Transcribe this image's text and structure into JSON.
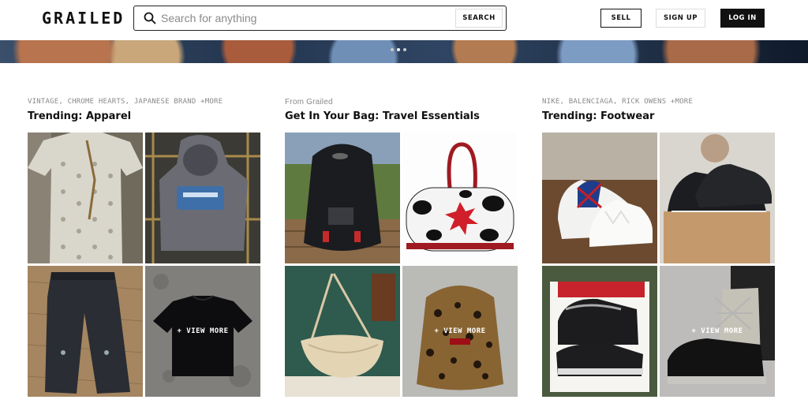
{
  "header": {
    "logo": "GRAILED",
    "search": {
      "placeholder": "Search for anything",
      "value": "",
      "button": "SEARCH"
    },
    "sell": "SELL",
    "signup": "SIGN UP",
    "login": "LOG IN"
  },
  "carousel": {
    "dots": 3,
    "active": 1
  },
  "sections": [
    {
      "subtitle": "VINTAGE, CHROME HEARTS, JAPANESE BRAND +MORE",
      "title": "Trending: Apparel",
      "view_more": "+ VIEW MORE",
      "tiles": [
        "monogram-tshirt",
        "gray-graphic-hoodie",
        "black-cargo-jeans",
        "black-tshirt"
      ]
    },
    {
      "subtitle": "From Grailed",
      "title": "Get In Your Bag: Travel Essentials",
      "view_more": "+ VIEW MORE",
      "tiles": [
        "black-backpack",
        "cow-print-duffel",
        "beige-shoulder-bag",
        "leopard-backpack"
      ]
    },
    {
      "subtitle": "NIKE, BALENCIAGA, RICK OWENS +MORE",
      "title": "Trending: Footwear",
      "view_more": "+ VIEW MORE",
      "tiles": [
        "union-jack-sneakers",
        "black-oakley-sneakers",
        "jordan-cement-sneakers",
        "rick-owens-high-tops"
      ]
    }
  ]
}
